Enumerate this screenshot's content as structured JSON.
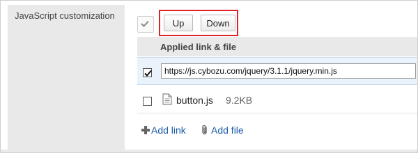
{
  "section": {
    "label": "JavaScript customization"
  },
  "toolbar": {
    "up_label": "Up",
    "down_label": "Down"
  },
  "table": {
    "header": "Applied link & file",
    "rows": [
      {
        "type": "link",
        "checked": true,
        "value": "https://js.cybozu.com/jquery/3.1.1/jquery.min.js"
      },
      {
        "type": "file",
        "checked": false,
        "name": "button.js",
        "size": "9.2KB"
      }
    ]
  },
  "actions": {
    "add_link": "Add link",
    "add_file": "Add file"
  },
  "colors": {
    "highlight": "#e0202a",
    "link": "#1a5aa8",
    "selected_row": "#eaf3fb"
  },
  "icons": {
    "check_all": "checkmark-icon",
    "file": "file-icon",
    "add_link": "plus-icon",
    "add_file": "paperclip-icon"
  }
}
